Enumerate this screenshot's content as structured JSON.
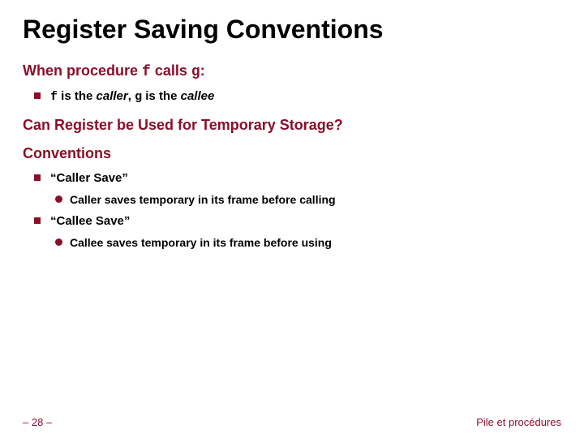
{
  "title": "Register Saving Conventions",
  "heading1_prefix": "When procedure ",
  "heading1_f": "f",
  "heading1_mid": " calls ",
  "heading1_g": "g",
  "heading1_suffix": ":",
  "b1_f": "f",
  "b1_mid1": " is the ",
  "b1_caller": "caller",
  "b1_mid2": ", ",
  "b1_g": "g",
  "b1_mid3": " is the ",
  "b1_callee": "callee",
  "heading2": "Can Register be Used for Temporary Storage?",
  "heading3": "Conventions",
  "b2": "“Caller Save”",
  "s2": "Caller saves temporary in its frame before calling",
  "b3": "“Callee Save”",
  "s3": "Callee saves temporary in its frame before using",
  "page_num": "– 28 –",
  "footer_right": "Pile et procédures"
}
